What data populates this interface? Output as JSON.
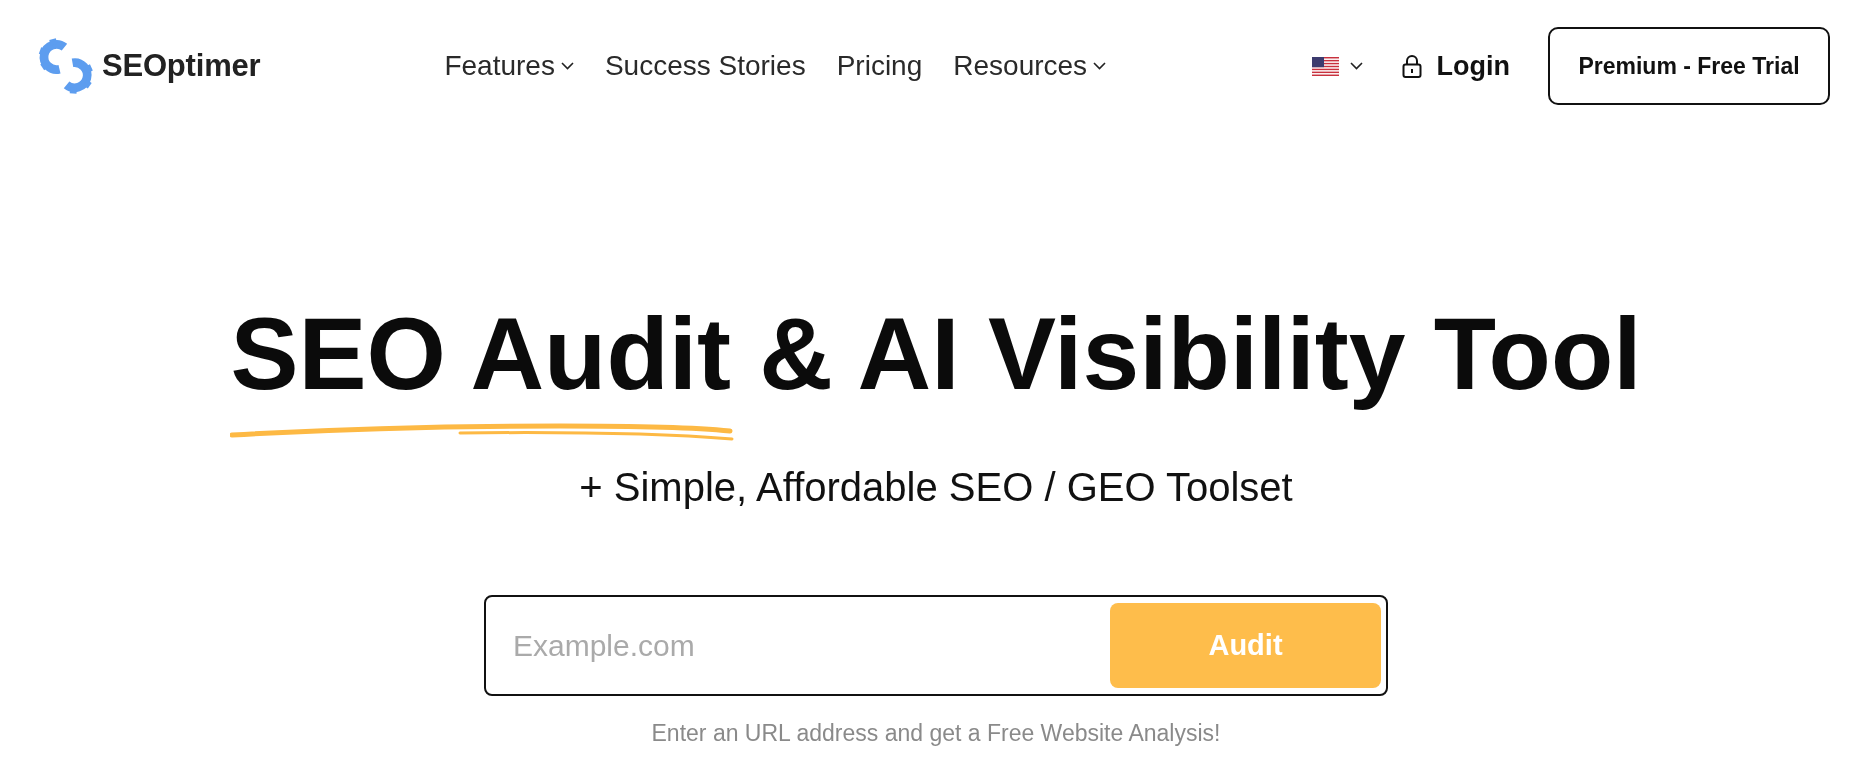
{
  "header": {
    "logo": "SEOptimer",
    "nav": [
      {
        "label": "Features",
        "dropdown": true
      },
      {
        "label": "Success Stories",
        "dropdown": false
      },
      {
        "label": "Pricing",
        "dropdown": false
      },
      {
        "label": "Resources",
        "dropdown": true
      }
    ],
    "language_selector": {
      "dropdown": true
    },
    "login": "Login",
    "cta": "Premium - Free Trial"
  },
  "hero": {
    "title": "SEO Audit & AI Visibility Tool",
    "subtitle": "+ Simple, Affordable SEO / GEO Toolset",
    "search": {
      "placeholder": "Example.com",
      "button": "Audit"
    },
    "hint": "Enter an URL address and get a Free Website Analysis!"
  }
}
